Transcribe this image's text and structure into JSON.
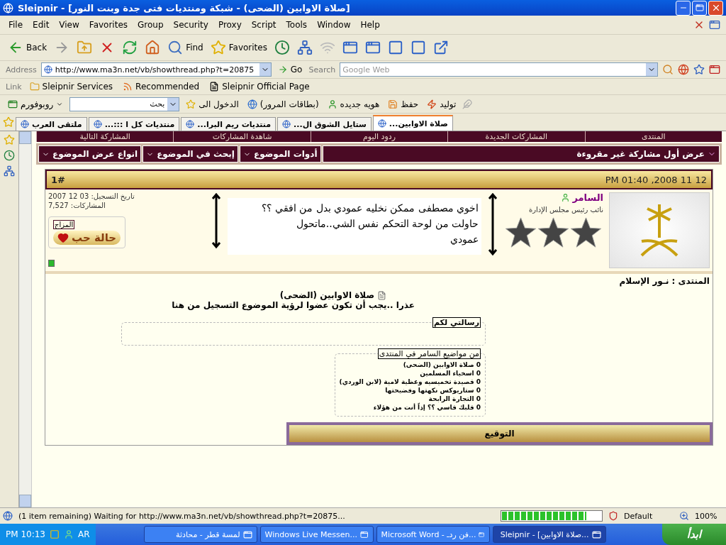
{
  "window": {
    "title": "Sleipnir - [صلاة الاوابين (الضحى) - شبكة ومنتديات فتى جدة وبنت النور]"
  },
  "menu": [
    "Help",
    "Window",
    "Tools",
    "Script",
    "Proxy",
    "Security",
    "Group",
    "Favorites",
    "View",
    "Edit",
    "File"
  ],
  "toolbar": [
    {
      "kind": "popout"
    },
    {
      "kind": "close-right"
    },
    {
      "kind": "close-left"
    },
    {
      "kind": "close-others"
    },
    {
      "kind": "close-all"
    },
    {
      "kind": "disabled"
    },
    {
      "kind": "tree"
    },
    {
      "kind": "history"
    },
    {
      "kind": "favorites",
      "label": "Favorites"
    },
    {
      "kind": "find",
      "label": "Find"
    },
    {
      "kind": "home"
    },
    {
      "kind": "refresh"
    },
    {
      "kind": "stop"
    },
    {
      "kind": "up"
    },
    {
      "kind": "forward"
    },
    {
      "kind": "back",
      "label": "Back"
    }
  ],
  "address_bar": {
    "label": "Address",
    "url": "http://www.ma3n.net/vb/showthread.php?t=20875",
    "go": "Go",
    "search_label": "Search",
    "search_placeholder": "Google Web"
  },
  "links_bar": {
    "label": "Link",
    "items": [
      "Sleipnir Official Page",
      "Recommended",
      "Sleipnir Services"
    ]
  },
  "roboform": {
    "name": "روبوفورم",
    "search": "بحث",
    "items": [
      {
        "kind": "generate",
        "label": "توليد"
      },
      {
        "kind": "save",
        "label": "حفظ"
      },
      {
        "kind": "identity",
        "label": "هويه جديده"
      },
      {
        "kind": "passcards",
        "label": "(بطاقات المرور)"
      },
      {
        "kind": "login",
        "label": "الدخول الى"
      }
    ]
  },
  "tabs": [
    {
      "label": "صلاة الاوابين...",
      "selected": true
    },
    {
      "label": "ستايل الشوق ال...",
      "selected": false
    },
    {
      "label": "منتديات ريم البرا...",
      "selected": false
    },
    {
      "label": "منتديات كل ا :::...",
      "selected": false
    },
    {
      "label": "ملتقى العرب",
      "selected": false
    }
  ],
  "forum": {
    "nav": [
      "المنتدى",
      "المشاركات الجديدة",
      "ردود اليوم",
      "شاهدة المشاركات",
      "المشاركة التالية"
    ],
    "first_unread": "عرض أول مشاركة غير مقروءة",
    "tools": [
      "أدوات الموضوع",
      "إبحث في الموضوع",
      "انواع عرض الموضوع"
    ],
    "post": {
      "date": "PM 01:40 ,2008 11 12",
      "number": "1#",
      "username": "السامر",
      "user_title": "نائب رئيس مجلس الإدارة",
      "online": true,
      "join_date": "تاريخ التسجيل: 03 12 2007",
      "posts": "المشاركات: 7,527",
      "mood_label": "المزاج",
      "mood": "حالة حب",
      "note": [
        "اخوي مصطفى ممكن نخليه عمودي بدل من افقي ؟؟",
        "حاولت من لوحة التحكم نفس  الشي..ماتحول",
        "عمودي"
      ],
      "forum_label": "المنتدى : نـور الإسلام",
      "title": "صلاة الاوابين (الضحى)",
      "message": "عذرا ..يجب أن تكون عضوا لرؤية الموضوع التسجيل من هنا",
      "letter_legend": "رسالتي لكم",
      "topics_legend": "من مواضيع السامر في المنتدى",
      "topics": [
        "0 صلاة الاوابين (الضحى)",
        "0 اسخياء المسلمين",
        "0 قصيدة تخميسيه وعظية لامية (لابن الوردي)",
        "0 ستاريوكس نكهتها وفضيحتها",
        "0 التجارة الرابحة",
        "0 قلبك قاسي ؟؟ إذاً أنت من هؤلاء"
      ],
      "signature": "التوقيع"
    }
  },
  "status_bar": {
    "text": "(1 item remaining) Waiting for http://www.ma3n.net/vb/showthread.php?t=20875...",
    "level": 0.85,
    "security": "Default",
    "zoom": "100%"
  },
  "taskbar": {
    "start": "ابدأ",
    "tasks": [
      {
        "label": "Sleipnir - [صلاة الاوابين...",
        "selected": true
      },
      {
        "label": "Microsoft Word - فن ردـ...",
        "selected": false
      },
      {
        "label": "Windows Live Messen...",
        "selected": false
      },
      {
        "label": "لمسة قطر - محادثة",
        "selected": false
      }
    ],
    "language": "AR",
    "clock": "PM 10:13"
  }
}
